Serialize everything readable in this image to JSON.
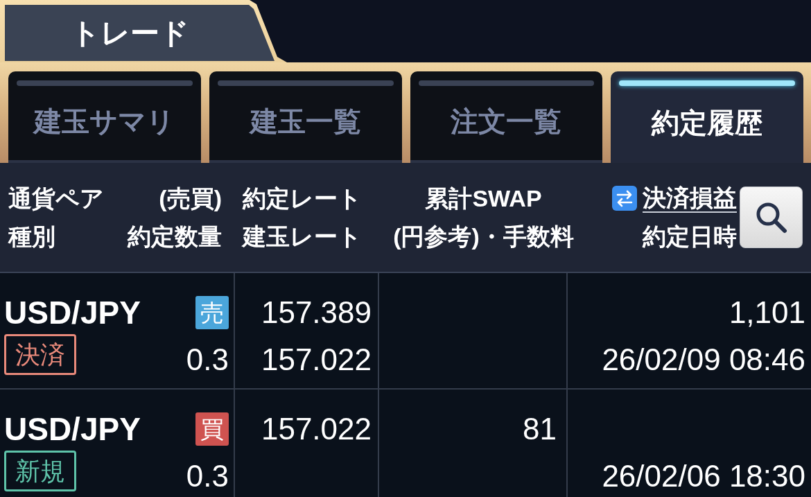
{
  "top_tab": {
    "label": "トレード"
  },
  "tabs": [
    {
      "label": "建玉サマリ",
      "selected": false
    },
    {
      "label": "建玉一覧",
      "selected": false
    },
    {
      "label": "注文一覧",
      "selected": false
    },
    {
      "label": "約定履歴",
      "selected": true
    }
  ],
  "table": {
    "header": {
      "pair": "通貨ペア",
      "side": "(売買)",
      "type": "種別",
      "quantity": "約定数量",
      "rate": "約定レート",
      "position_rate": "建玉レート",
      "swap": "累計SWAP",
      "swap_note": "(円参考)・手数料",
      "pnl": "決済損益",
      "datetime": "約定日時"
    },
    "rows": [
      {
        "pair": "USD/JPY",
        "side": {
          "label": "売",
          "color": "#4ba6db"
        },
        "type": {
          "label": "決済",
          "color": "#e8897a"
        },
        "quantity": "0.3",
        "rate": "157.389",
        "position_rate": "157.022",
        "pnl": "1,101",
        "datetime": "26/02/09 08:46"
      },
      {
        "pair": "USD/JPY",
        "side": {
          "label": "買",
          "color": "#cf5350"
        },
        "type": {
          "label": "新規",
          "color": "#5ec3a9"
        },
        "quantity": "0.3",
        "rate": "157.022",
        "swap": "81",
        "datetime": "26/02/06 18:30"
      }
    ]
  }
}
